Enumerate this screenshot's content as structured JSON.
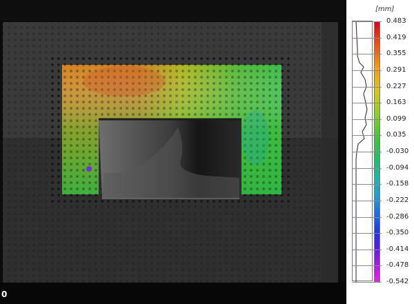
{
  "frame": {
    "index": "0"
  },
  "legend": {
    "unit": "[mm]",
    "ticks": [
      "0.483",
      "0.419",
      "0.355",
      "0.291",
      "0.227",
      "0.163",
      "0.099",
      "0.035",
      "-0.030",
      "-0.094",
      "-0.158",
      "-0.222",
      "-0.286",
      "-0.350",
      "-0.414",
      "-0.478",
      "-0.542"
    ],
    "colors": {
      "max": "#e3001b",
      "high": "#f5a015",
      "mid_high": "#d4c91a",
      "mid": "#3cc83a",
      "low_mid": "#1fb5a8",
      "low": "#1a3ae6",
      "min": "#f21ae8"
    }
  },
  "viewport": {
    "background": "#0b0b0b",
    "specimen_color": "#3a3a3a"
  }
}
